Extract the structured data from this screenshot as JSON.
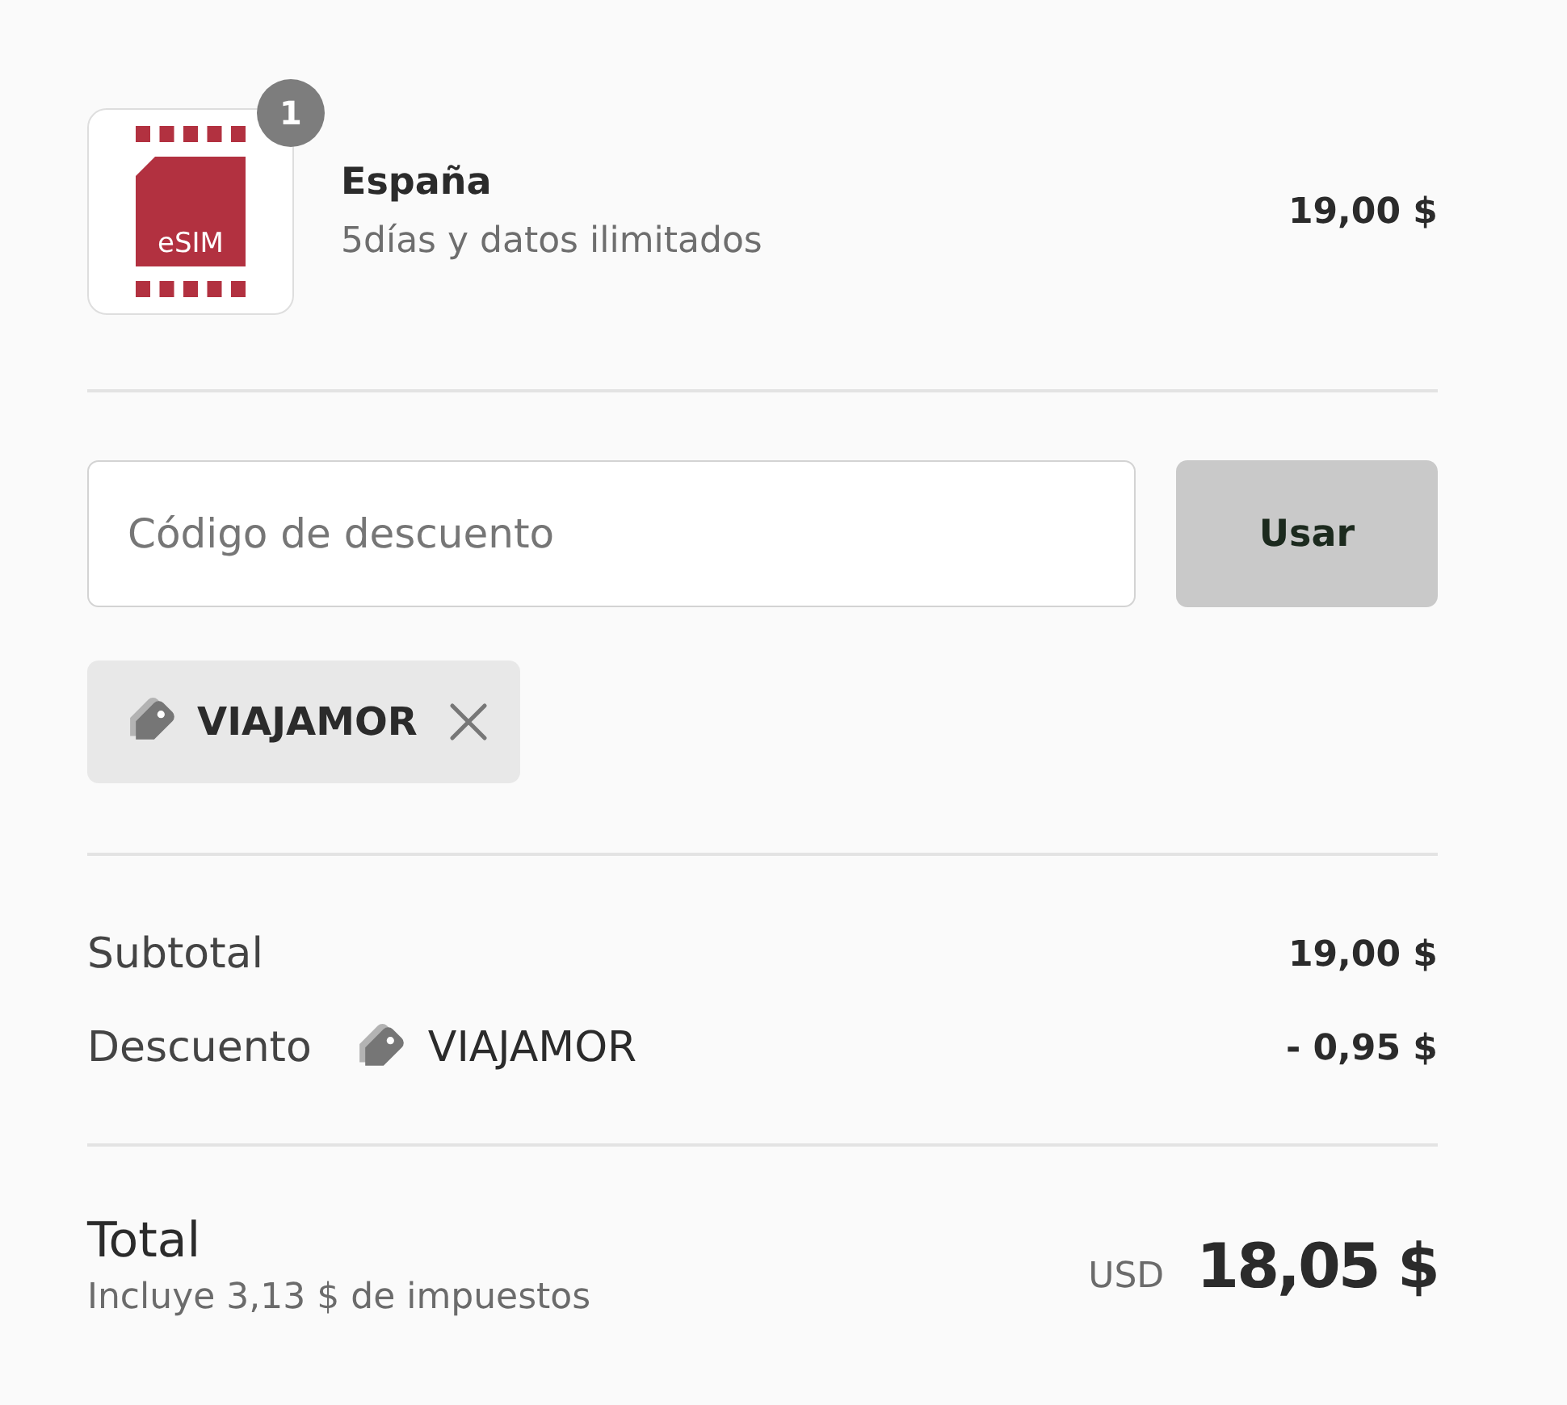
{
  "cart_items": [
    {
      "quantity": "1",
      "thumbnail_label": "eSIM",
      "title": "España",
      "subtitle": "5días y datos ilimitados",
      "price": "19,00 $"
    }
  ],
  "discount": {
    "placeholder": "Código de descuento",
    "apply_button": {
      "label": "Usar",
      "disabled": true
    },
    "applied_codes": [
      {
        "code": "VIAJAMOR"
      }
    ]
  },
  "summary": [
    {
      "kind": "plain",
      "label": "Subtotal",
      "value": "19,00 $"
    },
    {
      "kind": "discount",
      "label": "Descuento",
      "code": "VIAJAMOR",
      "value": "- 0,95 $"
    }
  ],
  "total": {
    "label": "Total",
    "note": "Incluye 3,13 $ de impuestos",
    "currency": "USD",
    "amount": "18,05 $"
  }
}
